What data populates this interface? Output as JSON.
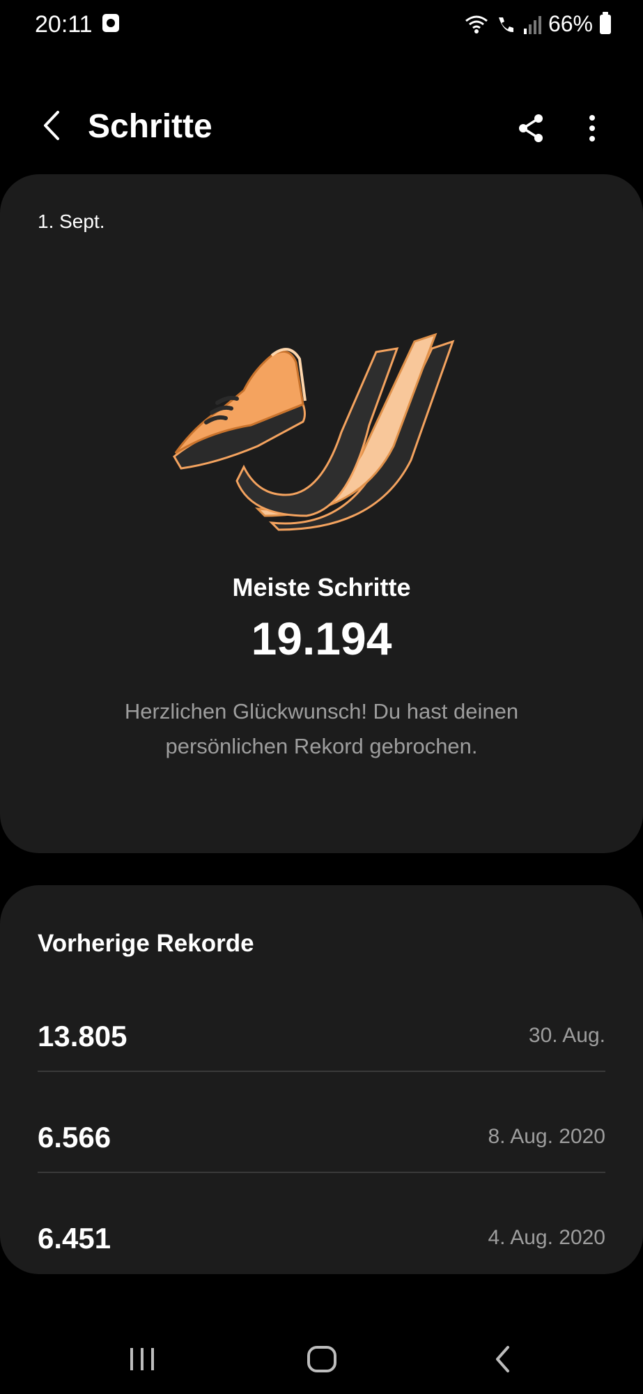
{
  "status_bar": {
    "time": "20:11",
    "battery": "66%"
  },
  "app_bar": {
    "title": "Schritte",
    "icons": [
      "back-arrow-icon",
      "share-icon",
      "more-vert-icon"
    ]
  },
  "hero": {
    "date": "1. Sept.",
    "label": "Meiste Schritte",
    "value": "19.194",
    "message": "Herzlichen Glückwunsch! Du hast deinen persönlichen Rekord gebrochen.",
    "accent_color": "#f4a35f"
  },
  "records": {
    "title": "Vorherige Rekorde",
    "items": [
      {
        "value": "13.805",
        "date": "30. Aug."
      },
      {
        "value": "6.566",
        "date": "8. Aug. 2020"
      },
      {
        "value": "6.451",
        "date": "4. Aug. 2020"
      }
    ]
  },
  "nav": {
    "icons": [
      "recents-icon",
      "home-icon",
      "back-icon"
    ]
  }
}
